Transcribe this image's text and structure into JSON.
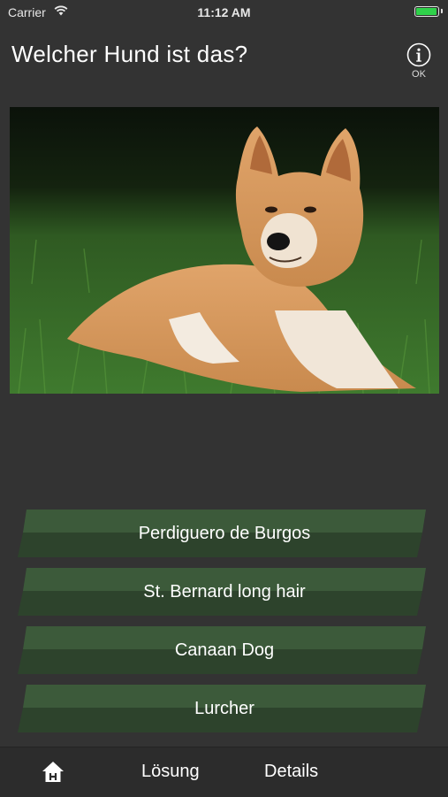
{
  "status_bar": {
    "carrier": "Carrier",
    "time": "11:12 AM",
    "wifi_icon": "wifi-icon",
    "battery_icon": "battery-icon",
    "battery_level": 1.0,
    "battery_color": "#2fd14a"
  },
  "header": {
    "title": "Welcher Hund ist das?",
    "info_icon": "info-icon",
    "info_label": "OK"
  },
  "photo": {
    "subject": "dog-photo"
  },
  "answers": [
    {
      "label": "Perdiguero de Burgos"
    },
    {
      "label": "St. Bernard long hair"
    },
    {
      "label": "Canaan Dog"
    },
    {
      "label": "Lurcher"
    }
  ],
  "tab_bar": {
    "home_icon": "home-icon",
    "solution_label": "Lösung",
    "details_label": "Details"
  },
  "colors": {
    "background": "#333333",
    "answer_top": "#3c5a3a",
    "answer_bottom": "#2d432c",
    "tab_bar": "#2c2c2c"
  }
}
